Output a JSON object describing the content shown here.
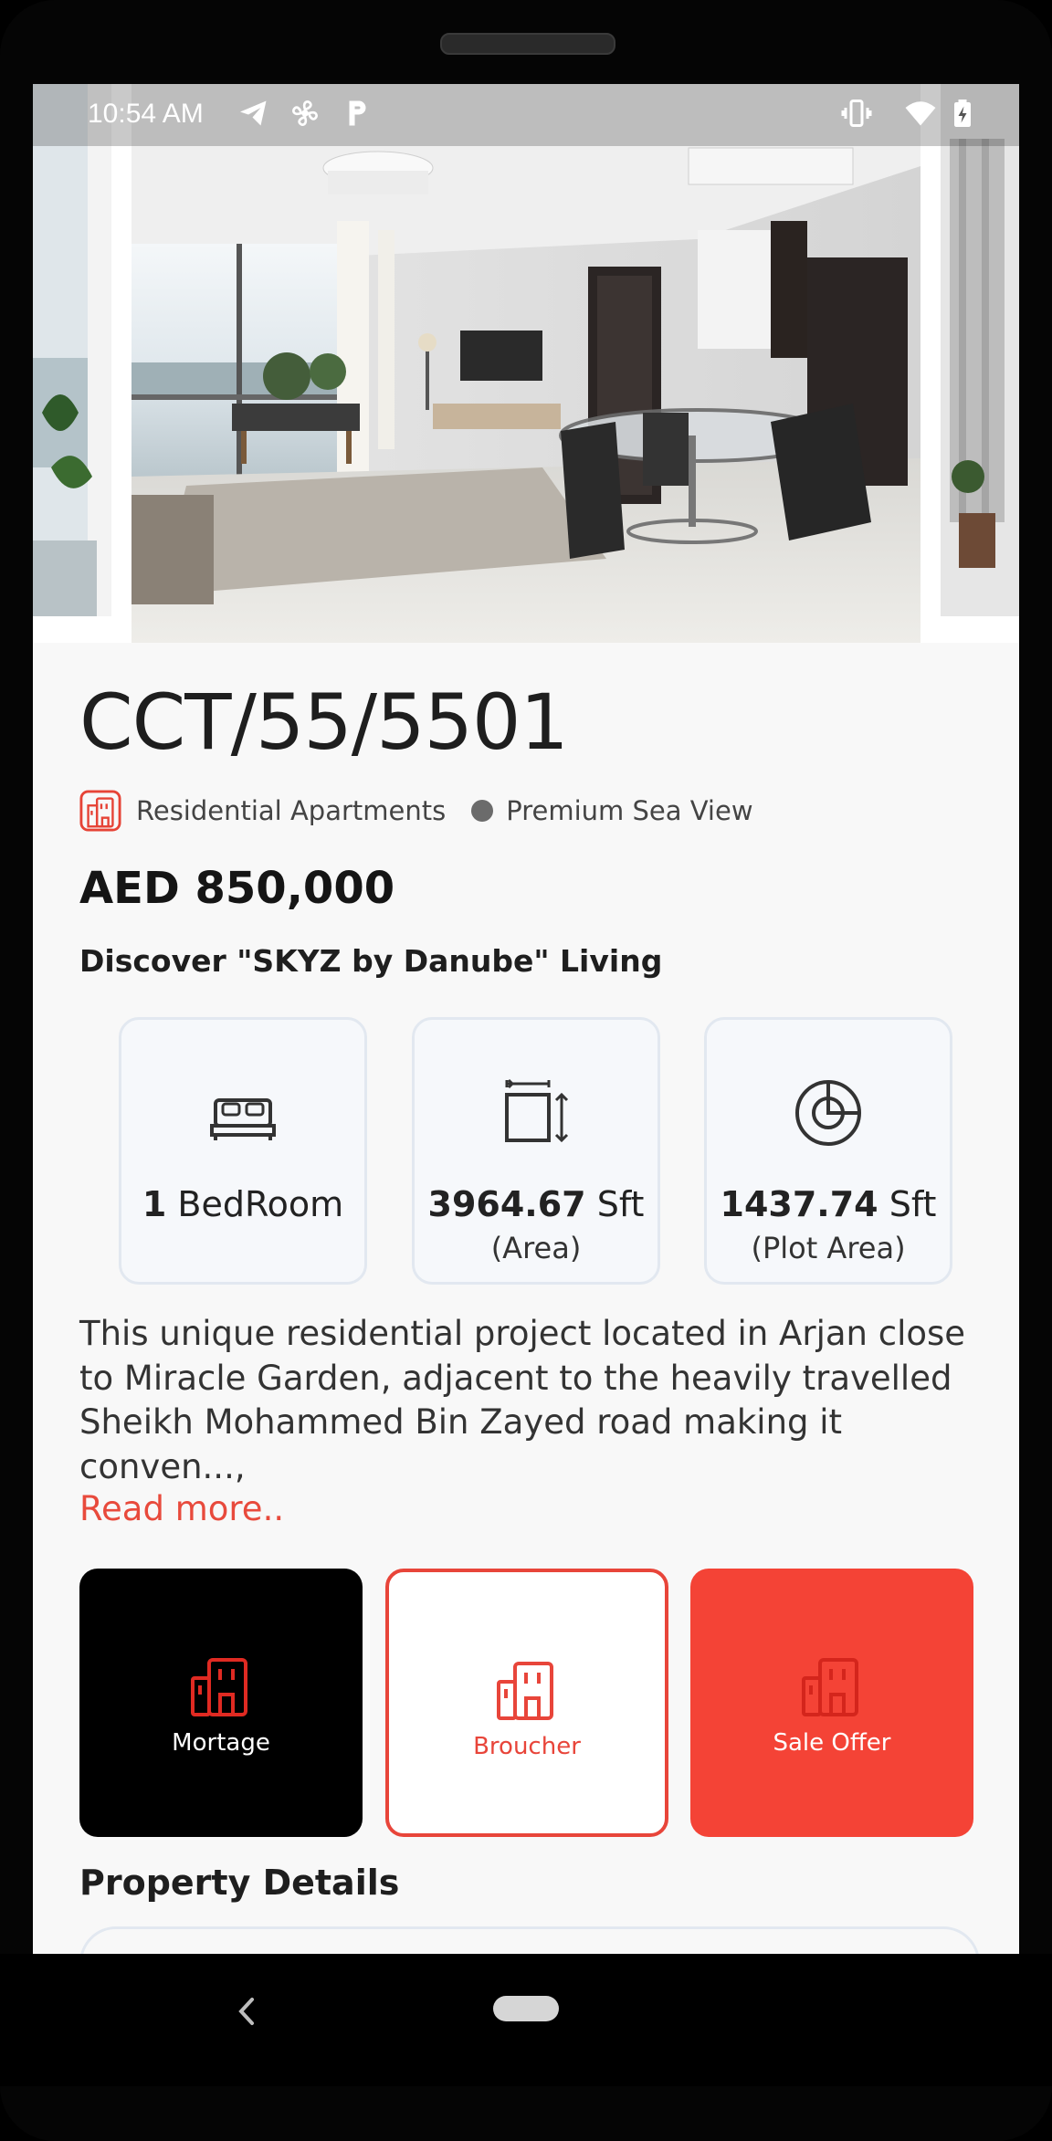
{
  "status_bar": {
    "time": "10:54 AM",
    "icons": [
      "telegram-icon",
      "fan-icon",
      "parking-icon",
      "vibrate-icon",
      "wifi-icon",
      "battery-charging-icon"
    ]
  },
  "gallery": {
    "images": [
      "living-room-photo-left",
      "living-dining-room-photo",
      "living-room-photo-right"
    ]
  },
  "property": {
    "code": "CCT/55/5501",
    "type": "Residential Apartments",
    "view": "Premium Sea View",
    "price": "AED 850,000",
    "tagline": "Discover \"SKYZ by Danube\" Living"
  },
  "features": [
    {
      "icon": "bed-icon",
      "value": "1",
      "unit": " BedRoom",
      "sub": ""
    },
    {
      "icon": "area-icon",
      "value": "3964.67",
      "unit": "  Sft",
      "sub": "(Area)"
    },
    {
      "icon": "plot-area-icon",
      "value": "1437.74",
      "unit": " Sft",
      "sub": "(Plot Area)"
    }
  ],
  "description": {
    "text": "This unique residential project located in Arjan close to Miracle Garden, adjacent to the heavily travelled Sheikh Mohammed Bin Zayed road making it conven...,",
    "read_more": "Read more.."
  },
  "actions": [
    {
      "label": "Mortage",
      "icon": "building-icon"
    },
    {
      "label": "Broucher",
      "icon": "building-icon"
    },
    {
      "label": "Sale Offer",
      "icon": "building-icon"
    }
  ],
  "sections": {
    "property_details": "Property Details"
  },
  "colors": {
    "accent": "#f44336",
    "accent_border": "#e8453a",
    "read_more": "#e84a3c",
    "dark_button": "#000000"
  }
}
